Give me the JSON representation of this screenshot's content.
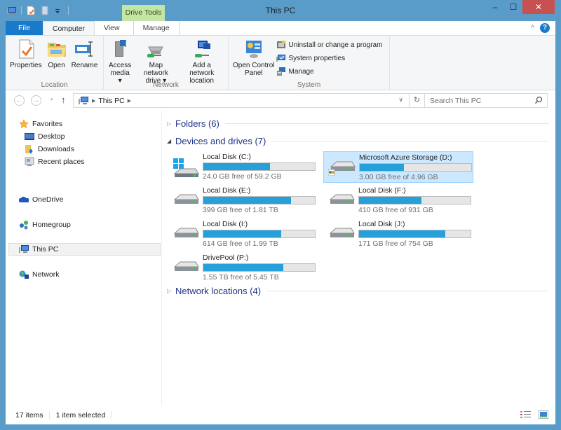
{
  "window": {
    "title": "This PC",
    "context_tab_group": "Drive Tools",
    "controls": {
      "minimize": "–",
      "maximize": "☐",
      "close": "✕"
    }
  },
  "quick_access": [
    "this-pc-icon",
    "properties-icon",
    "new-folder-icon",
    "customize-icon"
  ],
  "ribbon": {
    "tabs": [
      {
        "label": "File"
      },
      {
        "label": "Computer"
      },
      {
        "label": "View"
      },
      {
        "label": "Manage"
      }
    ],
    "active_tab": "Computer",
    "collapse_glyph": "^",
    "help_glyph": "?",
    "groups": {
      "location": {
        "label": "Location",
        "buttons": [
          {
            "label": "Properties",
            "icon": "properties-icon"
          },
          {
            "label": "Open",
            "icon": "open-folder-icon"
          },
          {
            "label": "Rename",
            "icon": "rename-icon"
          }
        ]
      },
      "network": {
        "label": "Network",
        "buttons": [
          {
            "label_line1": "Access",
            "label_line2": "media ▾",
            "icon": "access-media-icon"
          },
          {
            "label_line1": "Map network",
            "label_line2": "drive ▾",
            "icon": "map-network-drive-icon"
          },
          {
            "label_line1": "Add a network",
            "label_line2": "location",
            "icon": "add-network-location-icon"
          }
        ]
      },
      "system": {
        "label": "System",
        "big_button": {
          "label_line1": "Open Control",
          "label_line2": "Panel",
          "icon": "control-panel-icon"
        },
        "small_buttons": [
          {
            "label": "Uninstall or change a program",
            "icon": "uninstall-icon"
          },
          {
            "label": "System properties",
            "icon": "system-properties-icon"
          },
          {
            "label": "Manage",
            "icon": "manage-icon"
          }
        ]
      }
    }
  },
  "address_bar": {
    "back": "←",
    "forward": "→",
    "recent": "▾",
    "up": "↑",
    "crumbs": [
      "This PC"
    ],
    "search_placeholder": "Search This PC"
  },
  "nav_pane": {
    "favorites": {
      "label": "Favorites",
      "items": [
        "Desktop",
        "Downloads",
        "Recent places"
      ]
    },
    "onedrive": "OneDrive",
    "homegroup": "Homegroup",
    "this_pc": "This PC",
    "network": "Network"
  },
  "content": {
    "sections": {
      "folders": {
        "label": "Folders (6)",
        "expanded": false
      },
      "devices": {
        "label": "Devices and drives (7)",
        "expanded": true
      },
      "network_locations": {
        "label": "Network locations (4)",
        "expanded": false
      }
    },
    "drives": [
      {
        "name": "Local Disk (C:)",
        "free": "24.0 GB free of 59.2 GB",
        "used_fraction": 0.595,
        "selected": false,
        "icon": "windows-drive-icon"
      },
      {
        "name": "Microsoft Azure Storage (D:)",
        "free": "3.00 GB free of 4.96 GB",
        "used_fraction": 0.395,
        "selected": true,
        "icon": "shared-drive-icon"
      },
      {
        "name": "Local Disk (E:)",
        "free": "399 GB free of 1.81 TB",
        "used_fraction": 0.785,
        "selected": false,
        "icon": "hard-drive-icon"
      },
      {
        "name": "Local Disk (F:)",
        "free": "410 GB free of 931 GB",
        "used_fraction": 0.56,
        "selected": false,
        "icon": "hard-drive-icon"
      },
      {
        "name": "Local Disk (I:)",
        "free": "614 GB free of 1.99 TB",
        "used_fraction": 0.699,
        "selected": false,
        "icon": "hard-drive-icon"
      },
      {
        "name": "Local Disk (J:)",
        "free": "171 GB free of 754 GB",
        "used_fraction": 0.773,
        "selected": false,
        "icon": "hard-drive-icon"
      },
      {
        "name": "DrivePool (P:)",
        "free": "1.55 TB free of 5.45 TB",
        "used_fraction": 0.716,
        "selected": false,
        "icon": "hard-drive-icon"
      }
    ]
  },
  "status_bar": {
    "item_count": "17 items",
    "selection": "1 item selected"
  },
  "colors": {
    "frame": "#5a9cc9",
    "file_tab": "#1979ca",
    "context_tab": "#c5e5a5",
    "close_button": "#c75050",
    "usage_bar": "#26a0da",
    "section_header": "#1e3287",
    "selection_bg": "#cce8ff"
  }
}
